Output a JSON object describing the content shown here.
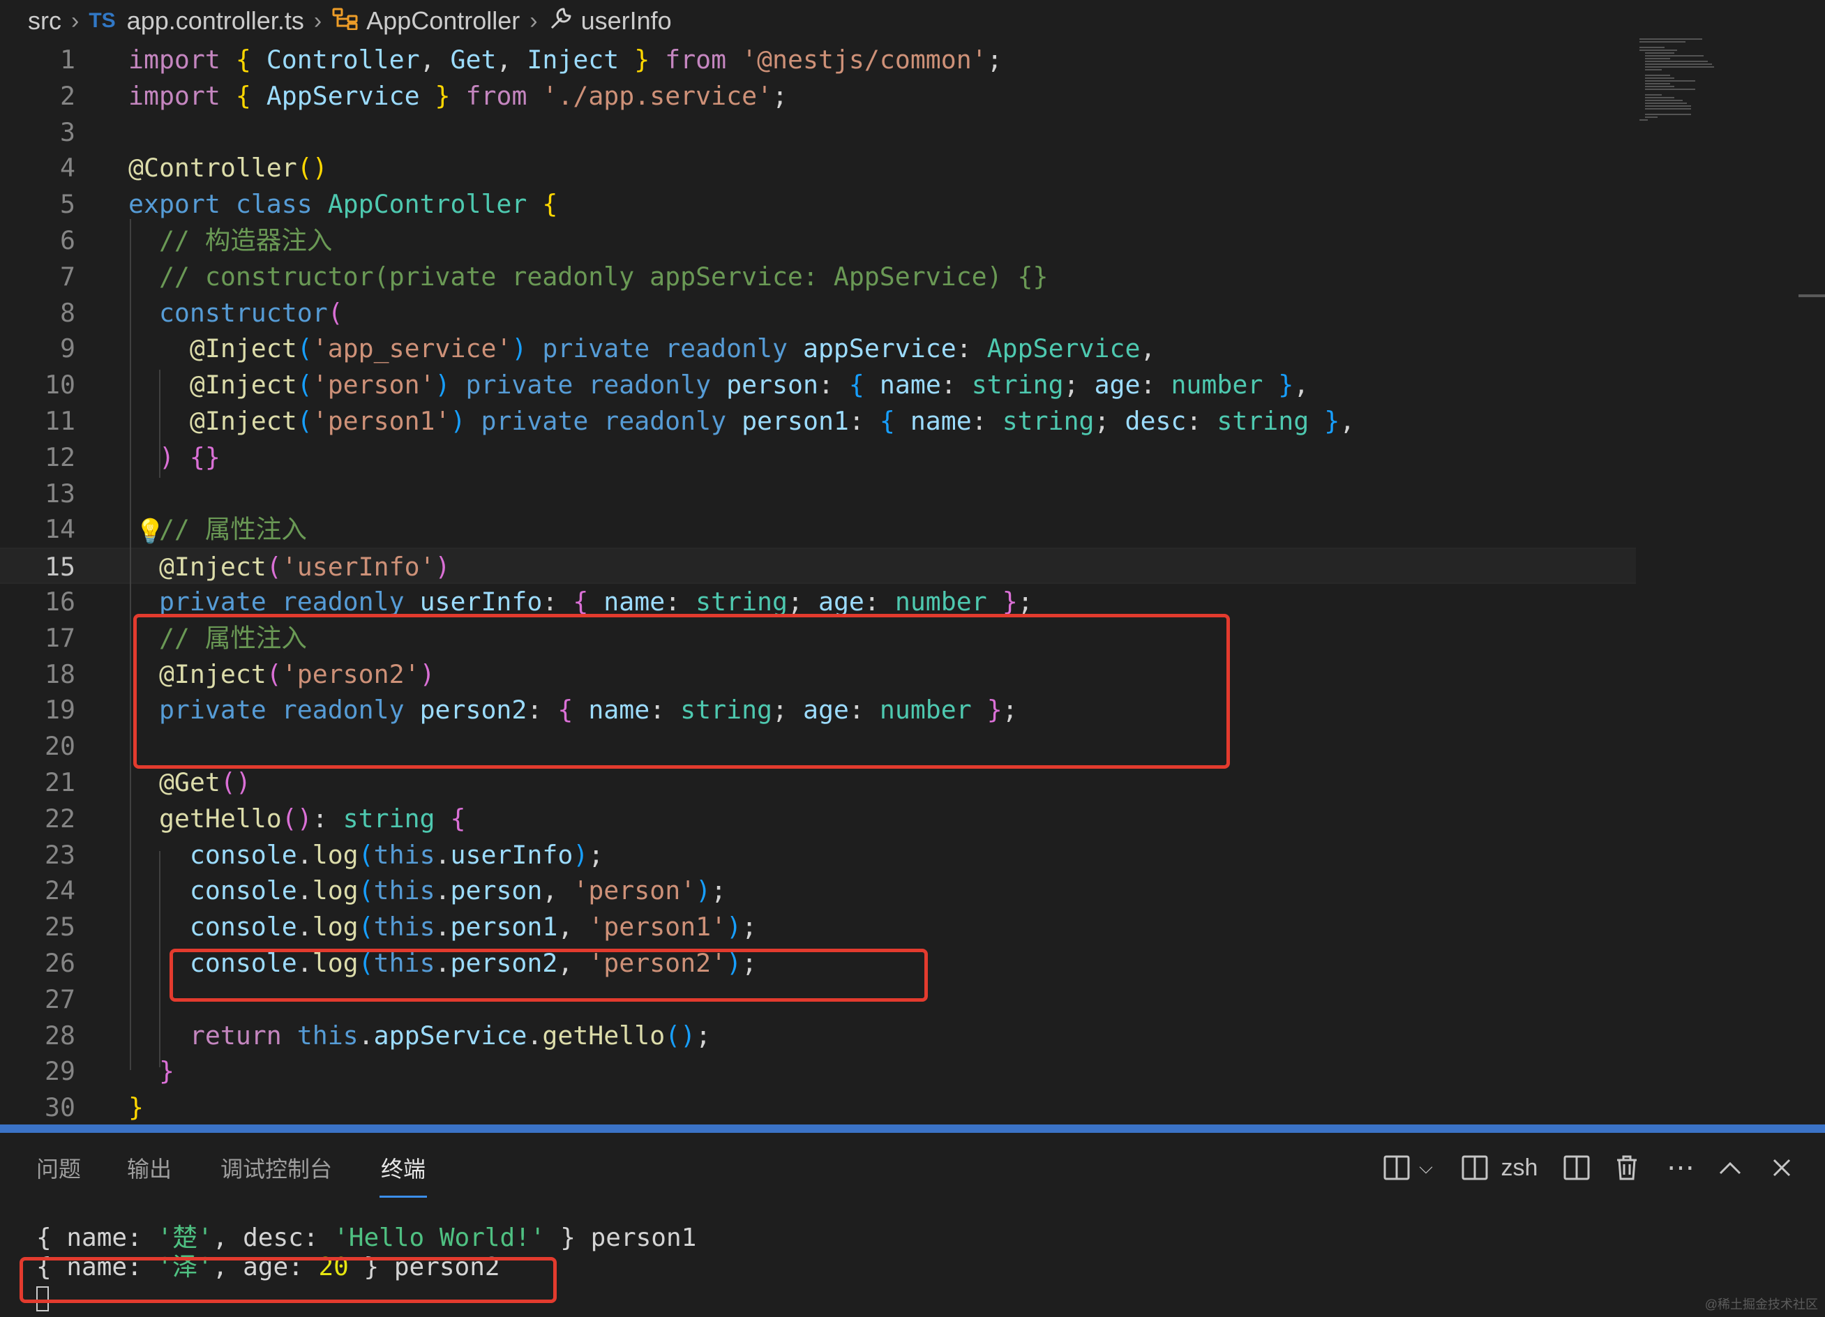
{
  "breadcrumb": {
    "folder": "src",
    "lang_badge": "TS",
    "file": "app.controller.ts",
    "class": "AppController",
    "member": "userInfo"
  },
  "editor": {
    "active_line": 15,
    "lines": [
      {
        "n": "1",
        "tokens": [
          [
            "k",
            "import"
          ],
          [
            "d",
            " "
          ],
          [
            "p1",
            "{"
          ],
          [
            "d",
            " "
          ],
          [
            "v",
            "Controller"
          ],
          [
            "d",
            ", "
          ],
          [
            "v",
            "Get"
          ],
          [
            "d",
            ", "
          ],
          [
            "v",
            "Inject"
          ],
          [
            "d",
            " "
          ],
          [
            "p1",
            "}"
          ],
          [
            "d",
            " "
          ],
          [
            "k",
            "from"
          ],
          [
            "d",
            " "
          ],
          [
            "s",
            "'@nestjs/common'"
          ],
          [
            "d",
            ";"
          ]
        ]
      },
      {
        "n": "2",
        "tokens": [
          [
            "k",
            "import"
          ],
          [
            "d",
            " "
          ],
          [
            "p1",
            "{"
          ],
          [
            "d",
            " "
          ],
          [
            "v",
            "AppService"
          ],
          [
            "d",
            " "
          ],
          [
            "p1",
            "}"
          ],
          [
            "d",
            " "
          ],
          [
            "k",
            "from"
          ],
          [
            "d",
            " "
          ],
          [
            "s",
            "'./app.service'"
          ],
          [
            "d",
            ";"
          ]
        ]
      },
      {
        "n": "3",
        "tokens": []
      },
      {
        "n": "4",
        "tokens": [
          [
            "f",
            "@Controller"
          ],
          [
            "p1",
            "()"
          ]
        ]
      },
      {
        "n": "5",
        "tokens": [
          [
            "kb",
            "export"
          ],
          [
            "d",
            " "
          ],
          [
            "kb",
            "class"
          ],
          [
            "d",
            " "
          ],
          [
            "t",
            "AppController"
          ],
          [
            "d",
            " "
          ],
          [
            "p1",
            "{"
          ]
        ]
      },
      {
        "n": "6",
        "tokens": [
          [
            "d",
            "  "
          ],
          [
            "c",
            "// 构造器注入"
          ]
        ]
      },
      {
        "n": "7",
        "tokens": [
          [
            "d",
            "  "
          ],
          [
            "c",
            "// constructor(private readonly appService: AppService) {}"
          ]
        ]
      },
      {
        "n": "8",
        "tokens": [
          [
            "d",
            "  "
          ],
          [
            "kb",
            "constructor"
          ],
          [
            "p2",
            "("
          ]
        ]
      },
      {
        "n": "9",
        "tokens": [
          [
            "d",
            "    "
          ],
          [
            "f",
            "@Inject"
          ],
          [
            "p3",
            "("
          ],
          [
            "s",
            "'app_service'"
          ],
          [
            "p3",
            ")"
          ],
          [
            "d",
            " "
          ],
          [
            "kb",
            "private"
          ],
          [
            "d",
            " "
          ],
          [
            "kb",
            "readonly"
          ],
          [
            "d",
            " "
          ],
          [
            "v",
            "appService"
          ],
          [
            "d",
            ": "
          ],
          [
            "t",
            "AppService"
          ],
          [
            "d",
            ","
          ]
        ]
      },
      {
        "n": "10",
        "tokens": [
          [
            "d",
            "    "
          ],
          [
            "f",
            "@Inject"
          ],
          [
            "p3",
            "("
          ],
          [
            "s",
            "'person'"
          ],
          [
            "p3",
            ")"
          ],
          [
            "d",
            " "
          ],
          [
            "kb",
            "private"
          ],
          [
            "d",
            " "
          ],
          [
            "kb",
            "readonly"
          ],
          [
            "d",
            " "
          ],
          [
            "v",
            "person"
          ],
          [
            "d",
            ": "
          ],
          [
            "p3",
            "{"
          ],
          [
            "d",
            " "
          ],
          [
            "v",
            "name"
          ],
          [
            "d",
            ": "
          ],
          [
            "t",
            "string"
          ],
          [
            "d",
            "; "
          ],
          [
            "v",
            "age"
          ],
          [
            "d",
            ": "
          ],
          [
            "t",
            "number"
          ],
          [
            "d",
            " "
          ],
          [
            "p3",
            "}"
          ],
          [
            "d",
            ","
          ]
        ]
      },
      {
        "n": "11",
        "tokens": [
          [
            "d",
            "    "
          ],
          [
            "f",
            "@Inject"
          ],
          [
            "p3",
            "("
          ],
          [
            "s",
            "'person1'"
          ],
          [
            "p3",
            ")"
          ],
          [
            "d",
            " "
          ],
          [
            "kb",
            "private"
          ],
          [
            "d",
            " "
          ],
          [
            "kb",
            "readonly"
          ],
          [
            "d",
            " "
          ],
          [
            "v",
            "person1"
          ],
          [
            "d",
            ": "
          ],
          [
            "p3",
            "{"
          ],
          [
            "d",
            " "
          ],
          [
            "v",
            "name"
          ],
          [
            "d",
            ": "
          ],
          [
            "t",
            "string"
          ],
          [
            "d",
            "; "
          ],
          [
            "v",
            "desc"
          ],
          [
            "d",
            ": "
          ],
          [
            "t",
            "string"
          ],
          [
            "d",
            " "
          ],
          [
            "p3",
            "}"
          ],
          [
            "d",
            ","
          ]
        ]
      },
      {
        "n": "12",
        "tokens": [
          [
            "d",
            "  "
          ],
          [
            "p2",
            ")"
          ],
          [
            "d",
            " "
          ],
          [
            "p2",
            "{}"
          ]
        ]
      },
      {
        "n": "13",
        "tokens": []
      },
      {
        "n": "14",
        "tokens": [
          [
            "d",
            "  "
          ],
          [
            "c",
            "// 属性注入"
          ]
        ]
      },
      {
        "n": "15",
        "tokens": [
          [
            "d",
            "  "
          ],
          [
            "f",
            "@Inject"
          ],
          [
            "p2",
            "("
          ],
          [
            "s",
            "'userInfo'"
          ],
          [
            "p2",
            ")"
          ]
        ]
      },
      {
        "n": "16",
        "tokens": [
          [
            "d",
            "  "
          ],
          [
            "kb",
            "private"
          ],
          [
            "d",
            " "
          ],
          [
            "kb",
            "readonly"
          ],
          [
            "d",
            " "
          ],
          [
            "v",
            "userInfo"
          ],
          [
            "d",
            ": "
          ],
          [
            "p2",
            "{"
          ],
          [
            "d",
            " "
          ],
          [
            "v",
            "name"
          ],
          [
            "d",
            ": "
          ],
          [
            "t",
            "string"
          ],
          [
            "d",
            "; "
          ],
          [
            "v",
            "age"
          ],
          [
            "d",
            ": "
          ],
          [
            "t",
            "number"
          ],
          [
            "d",
            " "
          ],
          [
            "p2",
            "}"
          ],
          [
            "d",
            ";"
          ]
        ]
      },
      {
        "n": "17",
        "tokens": [
          [
            "d",
            "  "
          ],
          [
            "c",
            "// 属性注入"
          ]
        ]
      },
      {
        "n": "18",
        "tokens": [
          [
            "d",
            "  "
          ],
          [
            "f",
            "@Inject"
          ],
          [
            "p2",
            "("
          ],
          [
            "s",
            "'person2'"
          ],
          [
            "p2",
            ")"
          ]
        ]
      },
      {
        "n": "19",
        "tokens": [
          [
            "d",
            "  "
          ],
          [
            "kb",
            "private"
          ],
          [
            "d",
            " "
          ],
          [
            "kb",
            "readonly"
          ],
          [
            "d",
            " "
          ],
          [
            "v",
            "person2"
          ],
          [
            "d",
            ": "
          ],
          [
            "p2",
            "{"
          ],
          [
            "d",
            " "
          ],
          [
            "v",
            "name"
          ],
          [
            "d",
            ": "
          ],
          [
            "t",
            "string"
          ],
          [
            "d",
            "; "
          ],
          [
            "v",
            "age"
          ],
          [
            "d",
            ": "
          ],
          [
            "t",
            "number"
          ],
          [
            "d",
            " "
          ],
          [
            "p2",
            "}"
          ],
          [
            "d",
            ";"
          ]
        ]
      },
      {
        "n": "20",
        "tokens": []
      },
      {
        "n": "21",
        "tokens": [
          [
            "d",
            "  "
          ],
          [
            "f",
            "@Get"
          ],
          [
            "p2",
            "()"
          ]
        ]
      },
      {
        "n": "22",
        "tokens": [
          [
            "d",
            "  "
          ],
          [
            "f",
            "getHello"
          ],
          [
            "p2",
            "()"
          ],
          [
            "d",
            ": "
          ],
          [
            "t",
            "string"
          ],
          [
            "d",
            " "
          ],
          [
            "p2",
            "{"
          ]
        ]
      },
      {
        "n": "23",
        "tokens": [
          [
            "d",
            "    "
          ],
          [
            "v",
            "console"
          ],
          [
            "d",
            "."
          ],
          [
            "f",
            "log"
          ],
          [
            "p3",
            "("
          ],
          [
            "kb",
            "this"
          ],
          [
            "d",
            "."
          ],
          [
            "v",
            "userInfo"
          ],
          [
            "p3",
            ")"
          ],
          [
            "d",
            ";"
          ]
        ]
      },
      {
        "n": "24",
        "tokens": [
          [
            "d",
            "    "
          ],
          [
            "v",
            "console"
          ],
          [
            "d",
            "."
          ],
          [
            "f",
            "log"
          ],
          [
            "p3",
            "("
          ],
          [
            "kb",
            "this"
          ],
          [
            "d",
            "."
          ],
          [
            "v",
            "person"
          ],
          [
            "d",
            ", "
          ],
          [
            "s",
            "'person'"
          ],
          [
            "p3",
            ")"
          ],
          [
            "d",
            ";"
          ]
        ]
      },
      {
        "n": "25",
        "tokens": [
          [
            "d",
            "    "
          ],
          [
            "v",
            "console"
          ],
          [
            "d",
            "."
          ],
          [
            "f",
            "log"
          ],
          [
            "p3",
            "("
          ],
          [
            "kb",
            "this"
          ],
          [
            "d",
            "."
          ],
          [
            "v",
            "person1"
          ],
          [
            "d",
            ", "
          ],
          [
            "s",
            "'person1'"
          ],
          [
            "p3",
            ")"
          ],
          [
            "d",
            ";"
          ]
        ]
      },
      {
        "n": "26",
        "tokens": [
          [
            "d",
            "    "
          ],
          [
            "v",
            "console"
          ],
          [
            "d",
            "."
          ],
          [
            "f",
            "log"
          ],
          [
            "p3",
            "("
          ],
          [
            "kb",
            "this"
          ],
          [
            "d",
            "."
          ],
          [
            "v",
            "person2"
          ],
          [
            "d",
            ", "
          ],
          [
            "s",
            "'person2'"
          ],
          [
            "p3",
            ")"
          ],
          [
            "d",
            ";"
          ]
        ]
      },
      {
        "n": "27",
        "tokens": []
      },
      {
        "n": "28",
        "tokens": [
          [
            "d",
            "    "
          ],
          [
            "k",
            "return"
          ],
          [
            "d",
            " "
          ],
          [
            "kb",
            "this"
          ],
          [
            "d",
            "."
          ],
          [
            "v",
            "appService"
          ],
          [
            "d",
            "."
          ],
          [
            "f",
            "getHello"
          ],
          [
            "p3",
            "()"
          ],
          [
            "d",
            ";"
          ]
        ]
      },
      {
        "n": "29",
        "tokens": [
          [
            "d",
            "  "
          ],
          [
            "p2",
            "}"
          ]
        ]
      },
      {
        "n": "30",
        "tokens": [
          [
            "p1",
            "}"
          ]
        ]
      }
    ]
  },
  "panel": {
    "tabs": [
      {
        "label": "问题",
        "active": false
      },
      {
        "label": "输出",
        "active": false
      },
      {
        "label": "调试控制台",
        "active": false
      },
      {
        "label": "终端",
        "active": true
      }
    ],
    "shell_label": "zsh",
    "terminal_lines": [
      [
        [
          "d",
          "{ name: "
        ],
        [
          "term-s",
          "'楚'"
        ],
        [
          "d",
          ", desc: "
        ],
        [
          "term-s",
          "'Hello World!'"
        ],
        [
          "d",
          " } person1"
        ]
      ],
      [
        [
          "d",
          "{ name: "
        ],
        [
          "term-s",
          "'泽'"
        ],
        [
          "d",
          ", age: "
        ],
        [
          "term-n",
          "20"
        ],
        [
          "d",
          " } person2"
        ]
      ]
    ]
  },
  "watermark": "@稀土掘金技术社区",
  "colors": {
    "editor_bg": "#1e1e1e",
    "panel_border": "#3b73c7",
    "highlight_box": "#e33b2e"
  }
}
